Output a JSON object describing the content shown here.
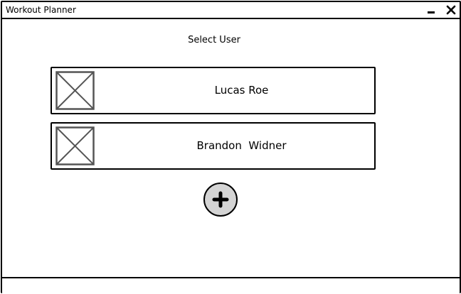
{
  "window": {
    "title": "Workout Planner",
    "minimize_icon": "minimize-icon",
    "close_icon": "close-icon"
  },
  "main": {
    "heading": "Select User",
    "users": [
      {
        "name": "Lucas Roe",
        "avatar_icon": "image-placeholder-icon"
      },
      {
        "name": "Brandon  Widner",
        "avatar_icon": "image-placeholder-icon"
      }
    ],
    "add_user_icon": "plus-icon"
  },
  "colors": {
    "border": "#000000",
    "background": "#ffffff",
    "add_button_fill": "#d4d4d4",
    "placeholder_stroke": "#555555"
  }
}
